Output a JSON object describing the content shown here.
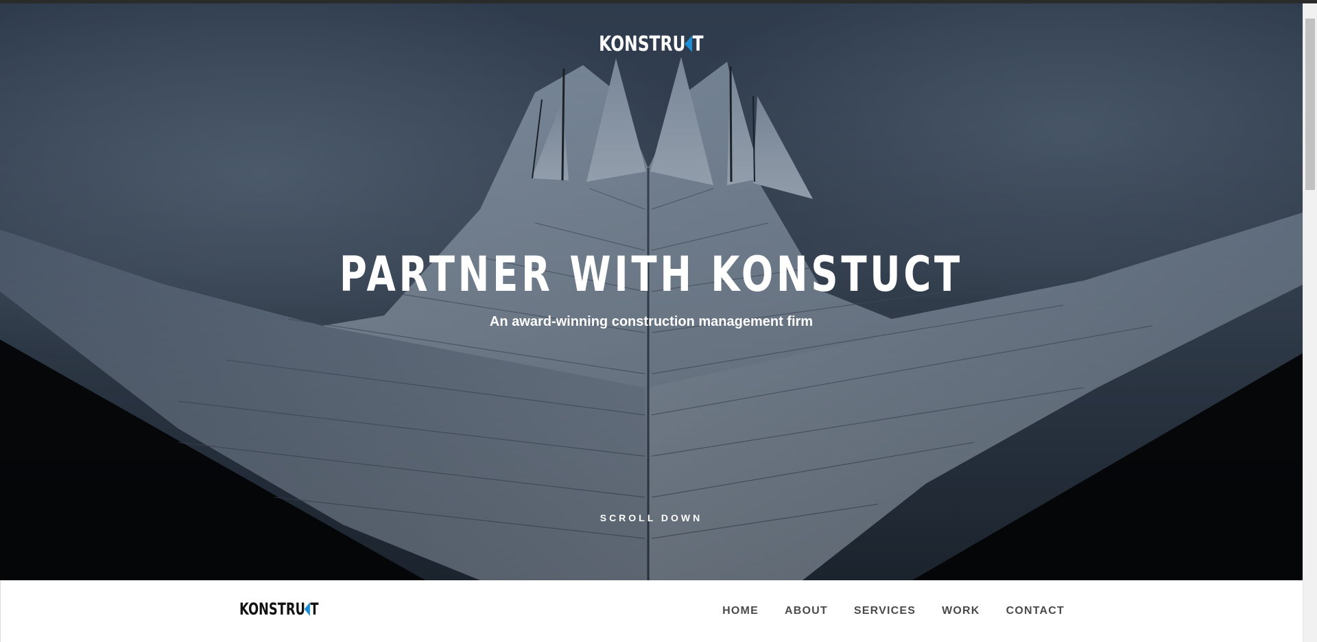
{
  "hero": {
    "logo_pre": "KONSTRU",
    "logo_post": "T",
    "title": "PARTNER WITH KONSTUCT",
    "subtitle": "An award-winning construction management firm",
    "scroll_label": "SCROLL DOWN"
  },
  "navbar": {
    "logo_pre": "KONSTRU",
    "logo_post": "T",
    "items": [
      {
        "label": "HOME"
      },
      {
        "label": "ABOUT"
      },
      {
        "label": "SERVICES"
      },
      {
        "label": "WORK"
      },
      {
        "label": "CONTACT"
      }
    ]
  },
  "colors": {
    "accent": "#1e8fd5",
    "nav_text": "#4a4a4a",
    "hero_overlay": "#1b2430"
  }
}
